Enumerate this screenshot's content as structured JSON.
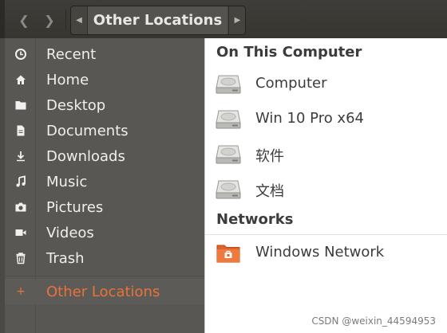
{
  "header": {
    "back_icon": "chevron-left-icon",
    "forward_icon": "chevron-right-icon",
    "path_left_icon": "triangle-left-icon",
    "path_right_icon": "triangle-right-icon",
    "crumb": "Other Locations"
  },
  "sidebar": {
    "items": [
      {
        "label": "Recent",
        "icon": "clock-icon"
      },
      {
        "label": "Home",
        "icon": "home-icon"
      },
      {
        "label": "Desktop",
        "icon": "folder-icon"
      },
      {
        "label": "Documents",
        "icon": "document-icon"
      },
      {
        "label": "Downloads",
        "icon": "download-icon"
      },
      {
        "label": "Music",
        "icon": "music-icon"
      },
      {
        "label": "Pictures",
        "icon": "camera-icon"
      },
      {
        "label": "Videos",
        "icon": "video-icon"
      },
      {
        "label": "Trash",
        "icon": "trash-icon"
      }
    ],
    "other": {
      "label": "Other Locations",
      "icon": "plus-icon"
    },
    "active_color": "#e8733a"
  },
  "content": {
    "on_this_computer": "On This Computer",
    "drives": [
      {
        "label": "Computer",
        "icon": "hard-drive-icon"
      },
      {
        "label": "Win 10 Pro x64",
        "icon": "hard-drive-icon"
      },
      {
        "label": "软件",
        "icon": "hard-drive-icon"
      },
      {
        "label": "文档",
        "icon": "hard-drive-icon"
      }
    ],
    "networks": "Networks",
    "network_items": [
      {
        "label": "Windows Network",
        "icon": "network-folder-icon"
      }
    ]
  },
  "watermark": "CSDN @weixin_44594953"
}
